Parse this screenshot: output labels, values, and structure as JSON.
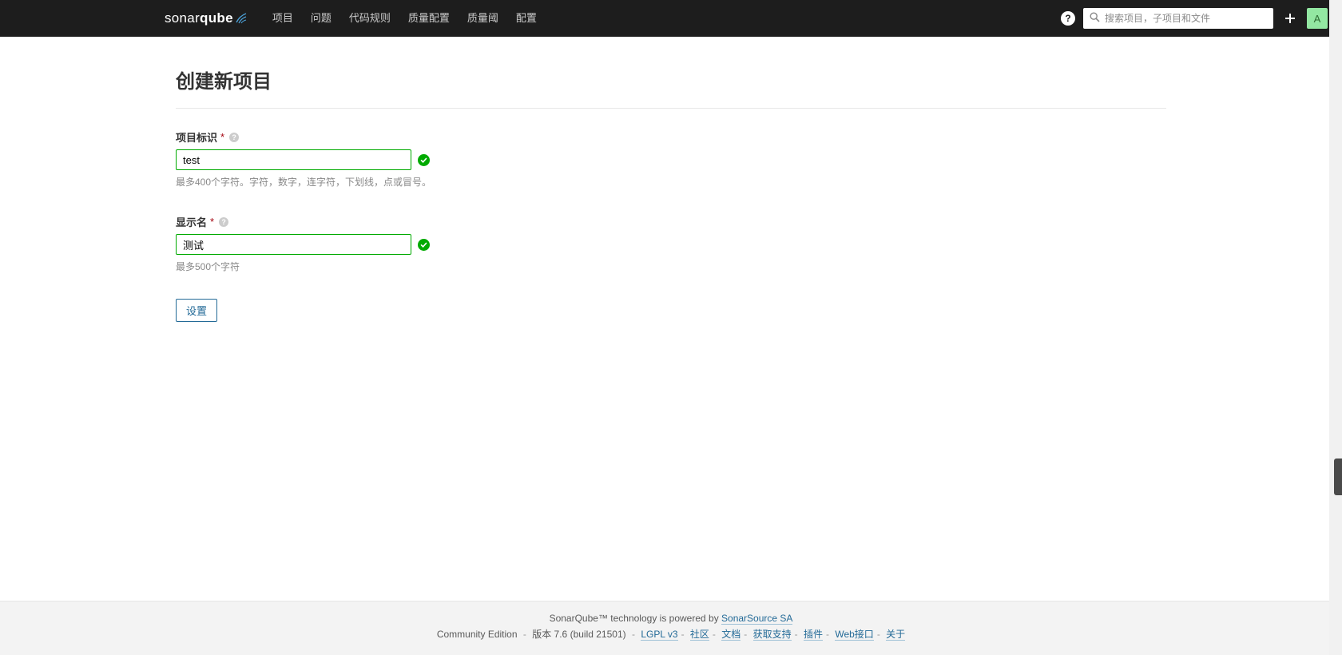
{
  "navbar": {
    "logo_prefix": "sonar",
    "logo_suffix": "qube",
    "menu": [
      "项目",
      "问题",
      "代码规则",
      "质量配置",
      "质量阈",
      "配置"
    ],
    "search_placeholder": "搜索项目，子项目和文件",
    "avatar_letter": "A"
  },
  "page": {
    "title": "创建新项目",
    "fields": {
      "key": {
        "label": "项目标识",
        "value": "test",
        "help": "最多400个字符。字符，数字，连字符，下划线，点或冒号。"
      },
      "name": {
        "label": "显示名",
        "value": "测试",
        "help": "最多500个字符"
      }
    },
    "submit_label": "设置"
  },
  "footer": {
    "line1_pre": "SonarQube™ technology is powered by ",
    "line1_link": "SonarSource SA",
    "edition": "Community Edition",
    "version": "版本 7.6 (build 21501)",
    "links": [
      "LGPL v3",
      "社区",
      "文档",
      "获取支持",
      "插件",
      "Web接口",
      "关于"
    ]
  }
}
